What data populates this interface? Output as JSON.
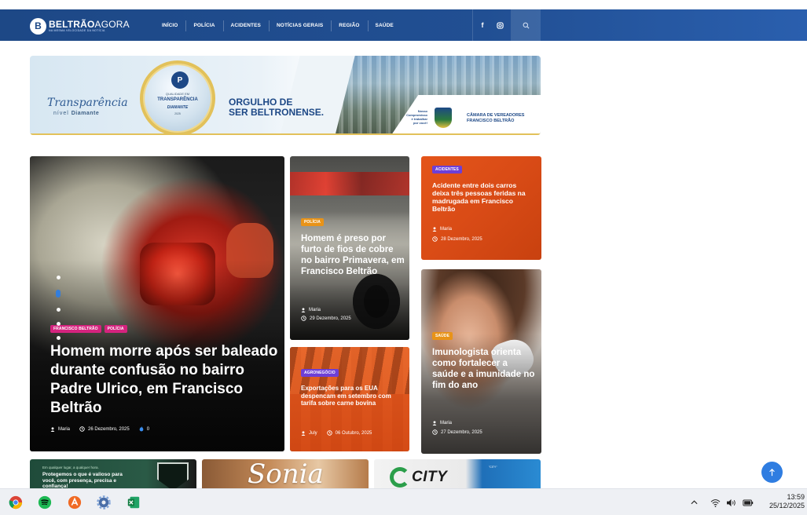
{
  "site": {
    "logo_name_bold": "BELTRÃO",
    "logo_name_light": "AGORA",
    "logo_tagline": "NA MESMA VELOCIDADE DA NOTÍCIA",
    "nav": [
      {
        "label": "INÍCIO"
      },
      {
        "label": "POLÍCIA"
      },
      {
        "label": "ACIDENTES"
      },
      {
        "label": "NOTÍCIAS GERAIS"
      },
      {
        "label": "REGIÃO"
      },
      {
        "label": "SAÚDE"
      }
    ],
    "social": {
      "facebook": "f",
      "instagram": "instagram-icon"
    },
    "search_icon": "search-icon"
  },
  "banner": {
    "transparencia": "Transparência",
    "nivel": "nível",
    "diamante": "Diamante",
    "medal_line1": "QUALIDADE EM",
    "medal_line2": "TRANSPARÊNCIA",
    "medal_line3": "DIAMANTE",
    "medal_line4": "2025",
    "orgulho_line1": "ORGULHO DE",
    "orgulho_line2": "SER BELTRONENSE.",
    "nosso_line1": "Nosso",
    "nosso_line2": "Compromisso",
    "nosso_line3": "é trabalhar",
    "nosso_line4": "por você!",
    "camara_line1": "CÂMARA DE VEREADORES",
    "camara_line2": "FRANCISCO BELTRÃO"
  },
  "featured": {
    "categories": [
      "FRANCISCO BELTRÃO",
      "POLÍCIA"
    ],
    "title": "Homem morre após ser baleado durante confusão no bairro Padre Ulrico, em Francisco Beltrão",
    "author": "Maria",
    "date": "26 Dezembro, 2025",
    "views": "0"
  },
  "card_police": {
    "category": "POLÍCIA",
    "title": "Homem é preso por furto de fios de cobre no bairro Primavera, em Francisco Beltrão",
    "author": "Maria",
    "date": "29 Dezembro, 2025"
  },
  "card_accident": {
    "category": "ACIDENTES",
    "title": "Acidente entre dois carros deixa três pessoas feridas na madrugada em Francisco Beltrão",
    "author": "Maria",
    "date": "28 Dezembro, 2025"
  },
  "card_agro": {
    "category": "AGRONEGÓCIO",
    "title": "Exportações para os EUA despencam em setembro com tarifa sobre carne bovina",
    "author": "July",
    "date": "06 Outubro, 2025"
  },
  "card_health": {
    "category": "SAÚDE",
    "title": "Imunologista orienta como fortalecer a saúde e a imunidade no fim do ano",
    "author": "Maria",
    "date": "27 Dezembro, 2025"
  },
  "ads": {
    "ad1_small": "Em qualquer lugar, a qualquer hora.",
    "ad1_text": "Protegemos o que é valioso para você, com presença, precisa e confiança!",
    "ad2_script": "Sonia",
    "ad3_brand": "CITY",
    "ad3_tag": "\"CITY\""
  },
  "taskbar": {
    "time": "13:59",
    "date": "25/12/2025"
  },
  "colors": {
    "nav_blue": "#1d4886",
    "accent_blue": "#2f7de1",
    "card_orange": "#e4551a",
    "cat_magenta": "#d4237e",
    "cat_purple": "#6d3fd6",
    "cat_orange": "#e89318"
  }
}
